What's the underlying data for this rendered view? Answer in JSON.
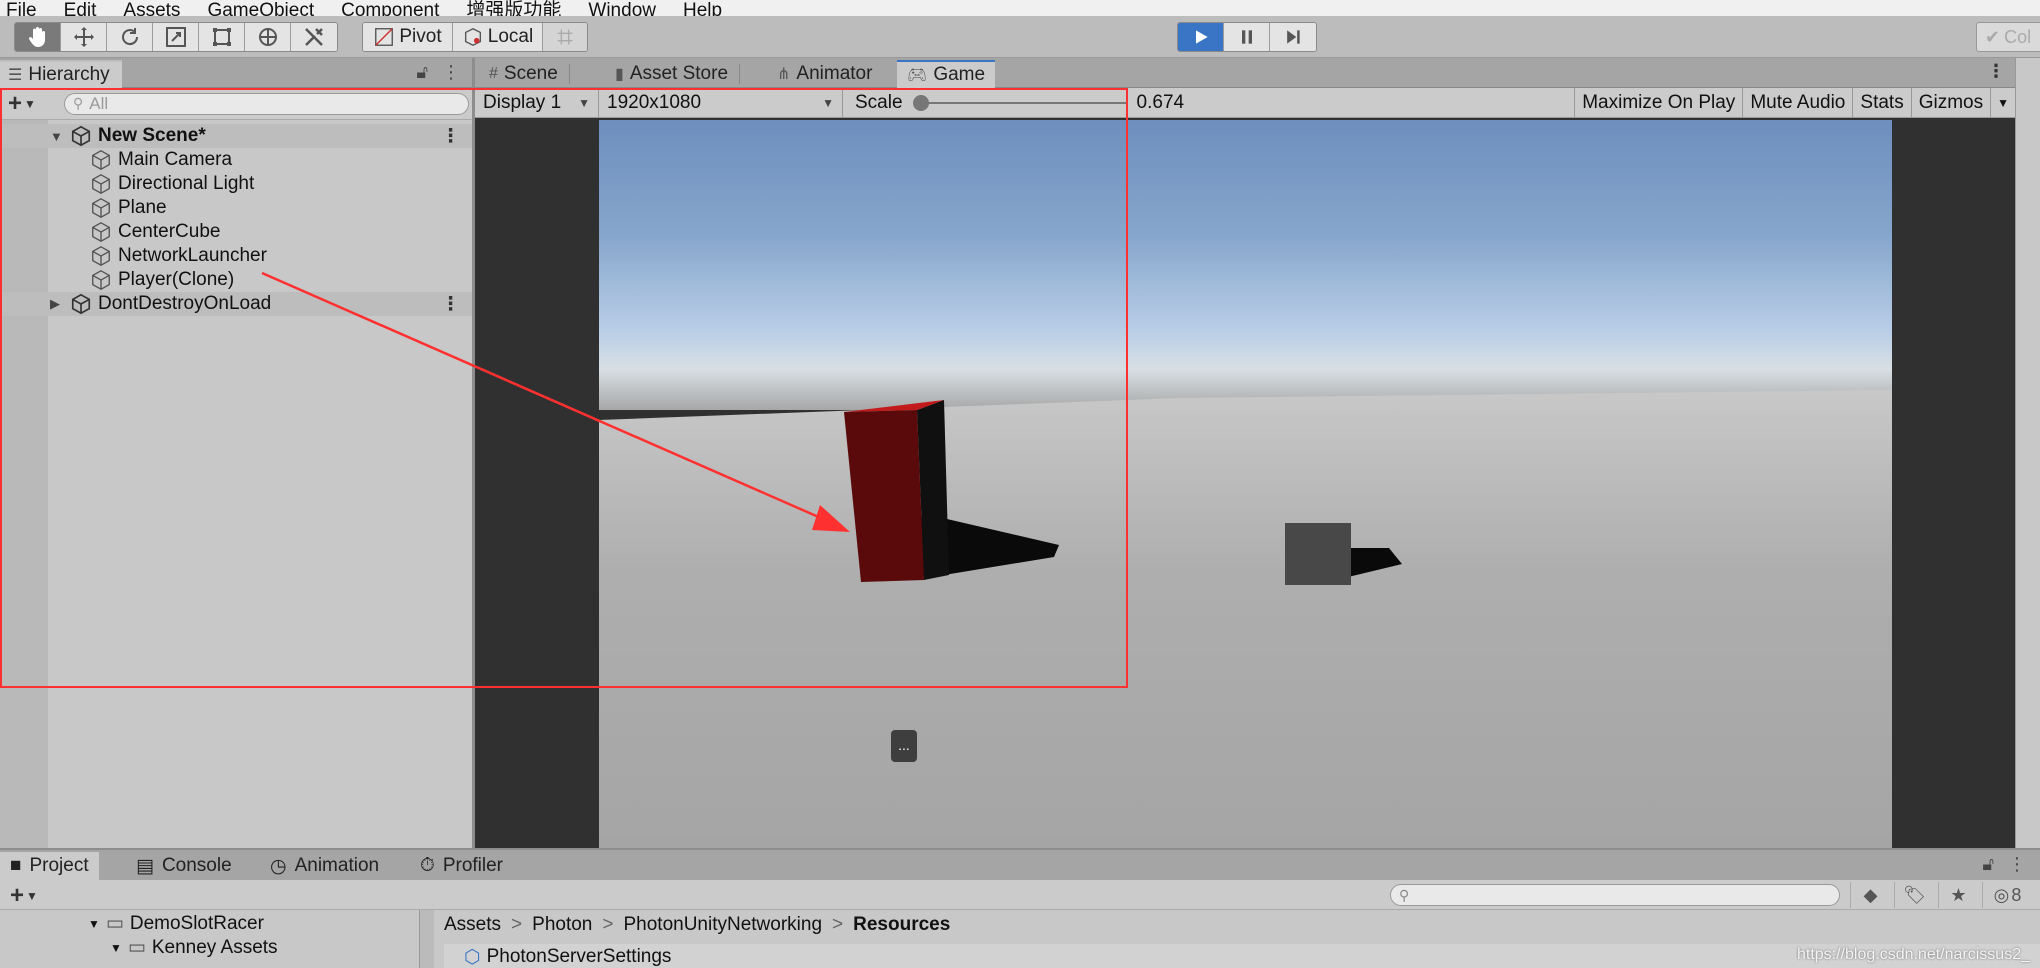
{
  "menu": {
    "items": [
      "File",
      "Edit",
      "Assets",
      "GameObject",
      "Component",
      "增强版功能",
      "Window",
      "Help"
    ]
  },
  "toolbar": {
    "tools": [
      "hand-tool",
      "move-tool",
      "rotate-tool",
      "scale-tool",
      "rect-tool",
      "transform-tool",
      "custom-tool"
    ],
    "pivot_label": "Pivot",
    "local_label": "Local",
    "collab_label": "Col"
  },
  "hierarchy": {
    "tab_label": "Hierarchy",
    "search_placeholder": "All",
    "scene_name": "New Scene*",
    "objects": [
      "Main Camera",
      "Directional Light",
      "Plane",
      "CenterCube",
      "NetworkLauncher",
      "Player(Clone)"
    ],
    "dont_destroy": "DontDestroyOnLoad"
  },
  "game": {
    "tabs": [
      "Scene",
      "Asset Store",
      "Animator",
      "Game"
    ],
    "active_tab": "Game",
    "display": "Display 1",
    "resolution": "1920x1080",
    "scale_label": "Scale",
    "scale_value": "0.674",
    "scale_fraction": 0.0,
    "maximize_label": "Maximize On Play",
    "mute_label": "Mute Audio",
    "stats_label": "Stats",
    "gizmos_label": "Gizmos",
    "overlay_text": "..."
  },
  "project": {
    "tabs": [
      "Project",
      "Console",
      "Animation",
      "Profiler"
    ],
    "tree": [
      "DemoSlotRacer",
      "Kenney Assets"
    ],
    "breadcrumb": [
      "Assets",
      "Photon",
      "PhotonUnityNetworking",
      "Resources"
    ],
    "asset": "PhotonServerSettings",
    "hidden_count": "8"
  },
  "watermark": "https://blog.csdn.net/narcissus2_",
  "colors": {
    "accent": "#3a74c4",
    "annotation": "#ff3030",
    "player_cube": "#5a0a0a",
    "center_cube": "#484848"
  }
}
